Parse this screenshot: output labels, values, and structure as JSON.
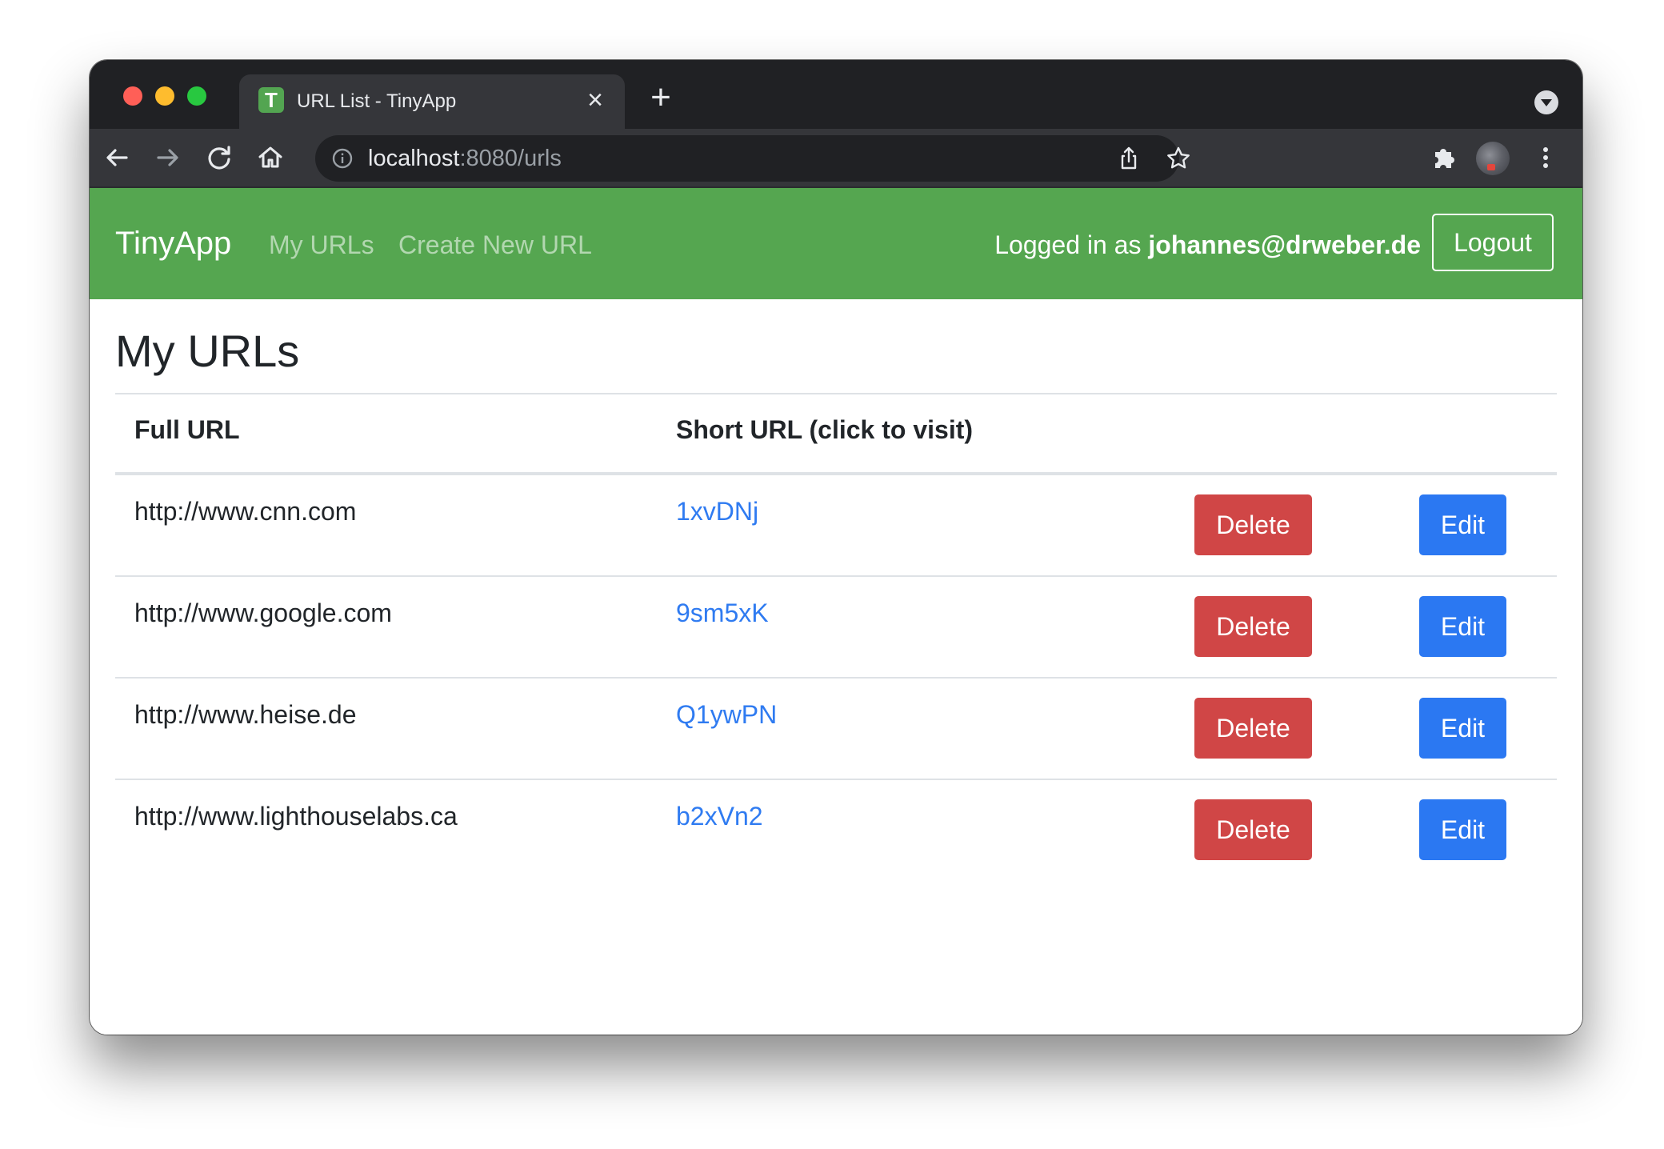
{
  "browser": {
    "tab": {
      "favicon_letter": "T",
      "title": "URL List - TinyApp",
      "close_symbol": "×"
    },
    "new_tab_symbol": "+",
    "address": {
      "host": "localhost",
      "rest": ":8080/urls"
    }
  },
  "navbar": {
    "brand": "TinyApp",
    "links": [
      "My URLs",
      "Create New URL"
    ],
    "login_prefix": "Logged in as ",
    "user_email": "johannes@drweber.de",
    "logout_label": "Logout",
    "background_color": "#55a650"
  },
  "main": {
    "title": "My URLs",
    "table": {
      "headers": [
        "Full URL",
        "Short URL (click to visit)"
      ],
      "rows": [
        {
          "full_url": "http://www.cnn.com",
          "short_url": "1xvDNj",
          "delete_label": "Delete",
          "edit_label": "Edit"
        },
        {
          "full_url": "http://www.google.com",
          "short_url": "9sm5xK",
          "delete_label": "Delete",
          "edit_label": "Edit"
        },
        {
          "full_url": "http://www.heise.de",
          "short_url": "Q1ywPN",
          "delete_label": "Delete",
          "edit_label": "Edit"
        },
        {
          "full_url": "http://www.lighthouselabs.ca",
          "short_url": "b2xVn2",
          "delete_label": "Delete",
          "edit_label": "Edit"
        }
      ]
    },
    "colors": {
      "link": "#2f7bf1",
      "delete": "#d04646",
      "edit": "#2b78f2"
    }
  },
  "icons": {
    "toolbar": [
      "back-arrow-icon",
      "forward-arrow-icon",
      "reload-icon",
      "home-icon",
      "info-icon",
      "share-icon",
      "star-icon",
      "extensions-puzzle-icon",
      "profile-avatar",
      "more-vertical-icon"
    ]
  }
}
